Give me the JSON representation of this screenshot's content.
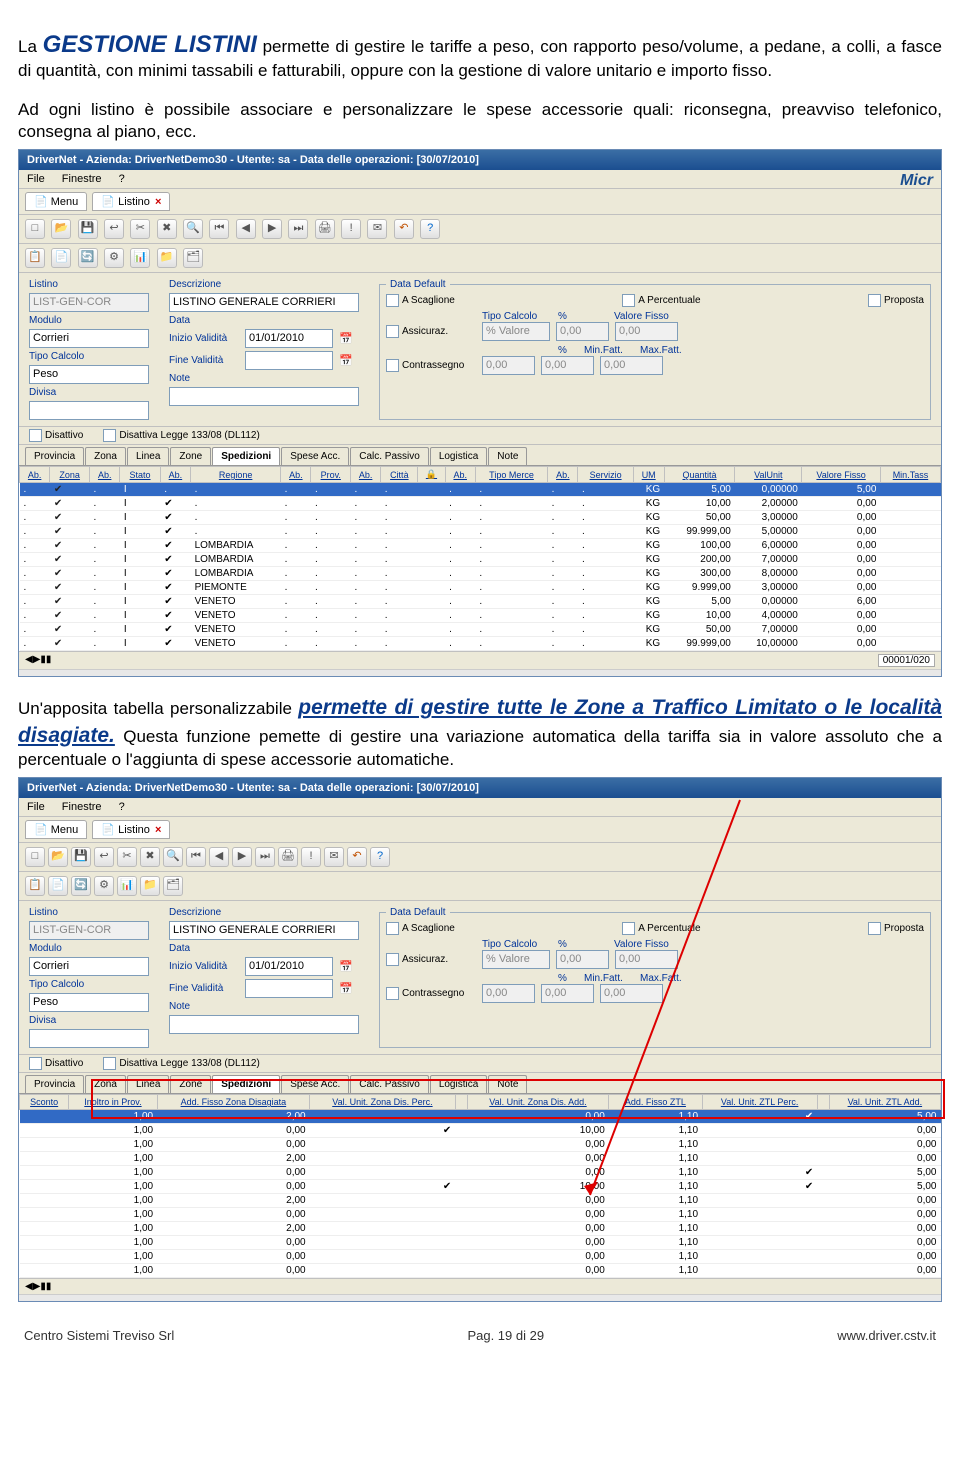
{
  "intro1_pre": "La ",
  "intro1_big": "GESTIONE LISTINI",
  "intro1_post": " permette di gestire le tariffe a peso, con rapporto peso/volume, a pedane, a colli, a fasce di quantità, con minimi tassabili e fatturabili, oppure con la gestione di valore unitario e importo fisso.",
  "intro2": "Ad ogni listino è possibile associare e personalizzare le spese accessorie quali: riconsegna, preavviso telefonico, consegna al piano, ecc.",
  "mid_pre": "Un'apposita tabella personalizzabile ",
  "mid_blue1": "permette di gestire tutte le Zone a Traffico Limitato o le località disagiate.",
  "mid_post": " Questa funzione pemette di gestire una variazione automatica della tariffa sia in valore assoluto che a percentuale o l'aggiunta di spese accessorie automatiche.",
  "window": {
    "title": "DriverNet - Azienda: DriverNetDemo30 - Utente: sa - Data delle operazioni: [30/07/2010]",
    "menu": [
      "File",
      "Finestre",
      "?"
    ],
    "tabs": [
      "Menu",
      "Listino"
    ],
    "brand": "Micr"
  },
  "form": {
    "listino_label": "Listino",
    "listino": "LIST-GEN-COR",
    "modulo_label": "Modulo",
    "modulo": "Corrieri",
    "tipo_label": "Tipo Calcolo",
    "tipo": "Peso",
    "divisa_label": "Divisa",
    "divisa": "",
    "desc_label": "Descrizione",
    "desc": "LISTINO GENERALE CORRIERI",
    "data_label": "Data",
    "iniziov_label": "Inizio Validità",
    "iniziov": "01/01/2010",
    "finev_label": "Fine Validità",
    "finev": "",
    "note_label": "Note",
    "note": "",
    "disattivo": "Disattivo",
    "disleg": "Disattiva Legge 133/08 (DL112)",
    "dd": {
      "legend": "Data Default",
      "asc": "A Scaglione",
      "aperc": "A Percentuale",
      "prop": "Proposta",
      "tipocalc": "Tipo Calcolo",
      "perc": "%",
      "valfisso": "Valore Fisso",
      "assic": "Assicuraz.",
      "pvalore": "% Valore",
      "v000": "0,00",
      "minfatt": "Min.Fatt.",
      "maxfatt": "Max.Fatt.",
      "contr": "Contrassegno"
    }
  },
  "tabs2": [
    "Provincia",
    "Zona",
    "Linea",
    "Zone",
    "Spedizioni",
    "Spese Acc.",
    "Calc. Passivo",
    "Logistica",
    "Note"
  ],
  "grid1": {
    "headers": [
      "Ab.",
      "Zona",
      "Ab.",
      "Stato",
      "Ab.",
      "Regione",
      "Ab.",
      "Prov.",
      "Ab.",
      "Città",
      "🔒",
      "Ab.",
      "Tipo Merce",
      "Ab.",
      "Servizio",
      "UM",
      "Quantità",
      "ValUnit",
      "Valore Fisso",
      "Min.Tass"
    ],
    "rows": [
      {
        "sel": true,
        "zona": "",
        "stato": "I",
        "reg": "",
        "um": "KG",
        "q": "5,00",
        "vu": "0,00000",
        "vf": "5,00"
      },
      {
        "zona": ".",
        "stato": "I",
        "reg": ".",
        "um": "KG",
        "q": "10,00",
        "vu": "2,00000",
        "vf": "0,00"
      },
      {
        "zona": ".",
        "stato": "I",
        "reg": ".",
        "um": "KG",
        "q": "50,00",
        "vu": "3,00000",
        "vf": "0,00"
      },
      {
        "zona": ".",
        "stato": "I",
        "reg": ".",
        "um": "KG",
        "q": "99.999,00",
        "vu": "5,00000",
        "vf": "0,00"
      },
      {
        "zona": ".",
        "stato": "I",
        "reg": "LOMBARDIA",
        "um": "KG",
        "q": "100,00",
        "vu": "6,00000",
        "vf": "0,00"
      },
      {
        "zona": ".",
        "stato": "I",
        "reg": "LOMBARDIA",
        "um": "KG",
        "q": "200,00",
        "vu": "7,00000",
        "vf": "0,00"
      },
      {
        "zona": ".",
        "stato": "I",
        "reg": "LOMBARDIA",
        "um": "KG",
        "q": "300,00",
        "vu": "8,00000",
        "vf": "0,00"
      },
      {
        "zona": ".",
        "stato": "I",
        "reg": "PIEMONTE",
        "um": "KG",
        "q": "9.999,00",
        "vu": "3,00000",
        "vf": "0,00"
      },
      {
        "zona": ".",
        "stato": "I",
        "reg": "VENETO",
        "um": "KG",
        "q": "5,00",
        "vu": "0,00000",
        "vf": "6,00"
      },
      {
        "zona": ".",
        "stato": "I",
        "reg": "VENETO",
        "um": "KG",
        "q": "10,00",
        "vu": "4,00000",
        "vf": "0,00"
      },
      {
        "zona": ".",
        "stato": "I",
        "reg": "VENETO",
        "um": "KG",
        "q": "50,00",
        "vu": "7,00000",
        "vf": "0,00"
      },
      {
        "zona": ".",
        "stato": "I",
        "reg": "VENETO",
        "um": "KG",
        "q": "99.999,00",
        "vu": "10,00000",
        "vf": "0,00"
      }
    ],
    "statusnav": "◀▶▮▮",
    "statuscount": "00001/020"
  },
  "grid2": {
    "headers": [
      "Sconto",
      "Inoltro in Prov.",
      "Add. Fisso Zona Disagiata",
      "Val. Unit. Zona Dis. Perc.",
      "",
      "Val. Unit. Zona Dis. Add.",
      "Add. Fisso ZTL",
      "Val. Unit. ZTL Perc.",
      "",
      "Val. Unit. ZTL Add."
    ],
    "rows": [
      {
        "sel": true,
        "sc": "",
        "ip": "1,00",
        "afzd": "2,00",
        "vzp": "",
        "c1": "",
        "vza": "0,00",
        "afztl": "1,10",
        "vzper": "✔",
        "vza2": "5,00"
      },
      {
        "sc": "",
        "ip": "1,00",
        "afzd": "0,00",
        "vzp": "✔",
        "c1": "",
        "vza": "10,00",
        "afztl": "1,10",
        "vzper": "",
        "vza2": "0,00"
      },
      {
        "sc": "",
        "ip": "1,00",
        "afzd": "0,00",
        "vzp": "",
        "c1": "",
        "vza": "0,00",
        "afztl": "1,10",
        "vzper": "",
        "vza2": "0,00"
      },
      {
        "sc": "",
        "ip": "1,00",
        "afzd": "2,00",
        "vzp": "",
        "c1": "",
        "vza": "0,00",
        "afztl": "1,10",
        "vzper": "",
        "vza2": "0,00"
      },
      {
        "sc": "",
        "ip": "1,00",
        "afzd": "0,00",
        "vzp": "",
        "c1": "",
        "vza": "0,00",
        "afztl": "1,10",
        "vzper": "✔",
        "vza2": "5,00"
      },
      {
        "sc": "",
        "ip": "1,00",
        "afzd": "0,00",
        "vzp": "✔",
        "c1": "",
        "vza": "10,00",
        "afztl": "1,10",
        "vzper": "✔",
        "vza2": "5,00"
      },
      {
        "sc": "",
        "ip": "1,00",
        "afzd": "2,00",
        "vzp": "",
        "c1": "",
        "vza": "0,00",
        "afztl": "1,10",
        "vzper": "",
        "vza2": "0,00"
      },
      {
        "sc": "",
        "ip": "1,00",
        "afzd": "0,00",
        "vzp": "",
        "c1": "",
        "vza": "0,00",
        "afztl": "1,10",
        "vzper": "",
        "vza2": "0,00"
      },
      {
        "sc": "",
        "ip": "1,00",
        "afzd": "2,00",
        "vzp": "",
        "c1": "",
        "vza": "0,00",
        "afztl": "1,10",
        "vzper": "",
        "vza2": "0,00"
      },
      {
        "sc": "",
        "ip": "1,00",
        "afzd": "0,00",
        "vzp": "",
        "c1": "",
        "vza": "0,00",
        "afztl": "1,10",
        "vzper": "",
        "vza2": "0,00"
      },
      {
        "sc": "",
        "ip": "1,00",
        "afzd": "0,00",
        "vzp": "",
        "c1": "",
        "vza": "0,00",
        "afztl": "1,10",
        "vzper": "",
        "vza2": "0,00"
      },
      {
        "sc": "",
        "ip": "1,00",
        "afzd": "0,00",
        "vzp": "",
        "c1": "",
        "vza": "0,00",
        "afztl": "1,10",
        "vzper": "",
        "vza2": "0,00"
      }
    ]
  },
  "footer": {
    "left": "Centro Sistemi Treviso Srl",
    "mid": "Pag. 19 di 29",
    "right": "www.driver.cstv.it"
  }
}
